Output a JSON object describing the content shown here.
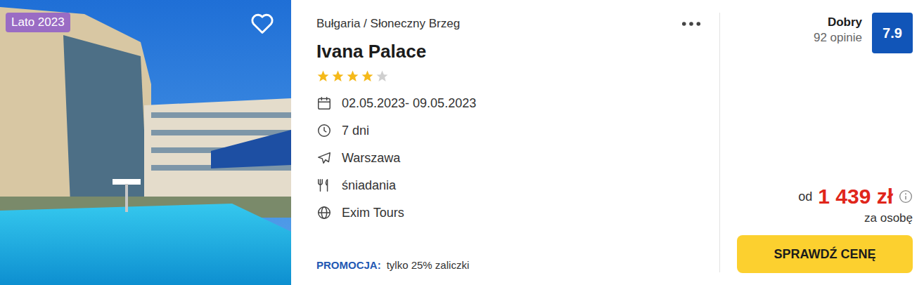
{
  "badge": "Lato 2023",
  "favorite": false,
  "location": "Bułgaria / Słoneczny Brzeg",
  "title": "Ivana Palace",
  "stars": 4,
  "maxStars": 5,
  "details": [
    {
      "kind": "calendar",
      "text": "02.05.2023- 09.05.2023"
    },
    {
      "kind": "clock",
      "text": "7 dni"
    },
    {
      "kind": "plane",
      "text": "Warszawa"
    },
    {
      "kind": "food",
      "text": "śniadania"
    },
    {
      "kind": "globe",
      "text": "Exim Tours"
    }
  ],
  "promo": {
    "label": "PROMOCJA:",
    "text": "tylko 25% zaliczki"
  },
  "rating": {
    "label": "Dobry",
    "reviews": "92 opinie",
    "score": "7.9"
  },
  "price": {
    "prefix": "od",
    "amount": "1 439 zł",
    "per": "za osobę"
  },
  "button": "SPRAWDŹ CENĘ"
}
